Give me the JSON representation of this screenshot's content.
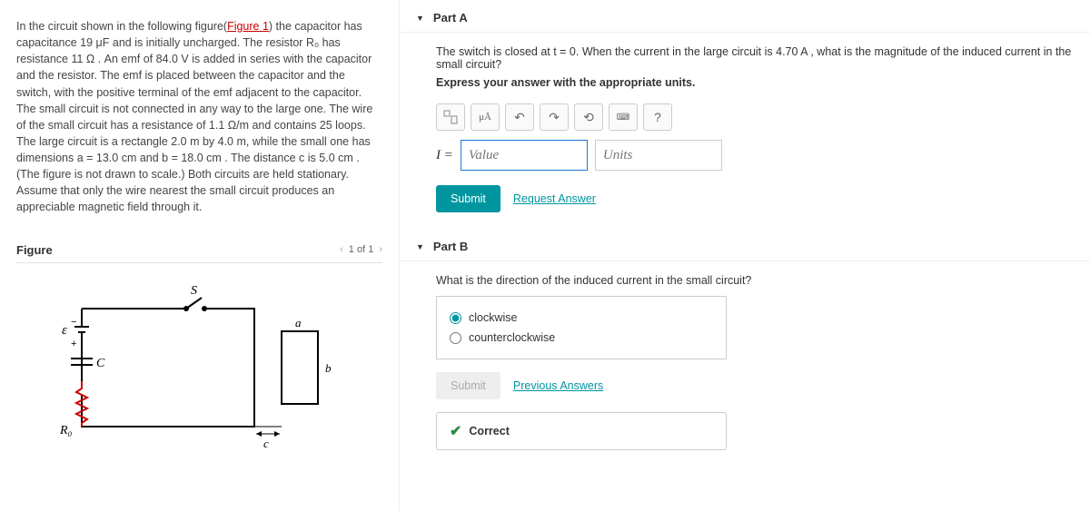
{
  "problem": {
    "text_parts": [
      "In the circuit shown in the following figure(",
      "Figure 1",
      ") the capacitor has capacitance 19 μF and is initially uncharged. The resistor R₀ has resistance 11 Ω . An emf of 84.0 V is added in series with the capacitor and the resistor. The emf is placed between the capacitor and the switch, with the positive terminal of the emf adjacent to the capacitor. The small circuit is not connected in any way to the large one. The wire of the small circuit has a resistance of 1.1 Ω/m and contains 25 loops. The large circuit is a rectangle 2.0 m by 4.0 m, while the small one has dimensions a = 13.0 cm and b = 18.0 cm . The distance c is 5.0 cm . (The figure is not drawn to scale.) Both circuits are held stationary. Assume that only the wire nearest the small circuit produces an appreciable magnetic field through it."
    ]
  },
  "figure": {
    "title": "Figure",
    "pager_current": "1 of 1",
    "labels": {
      "emf": "ε",
      "switch": "S",
      "cap": "C",
      "res": "R₀",
      "a": "a",
      "b": "b",
      "c": "c"
    }
  },
  "partA": {
    "title": "Part A",
    "question": "The switch is closed at t = 0. When the current in the large circuit is 4.70 A , what is the magnitude of the induced current in the small circuit?",
    "instruction": "Express your answer with the appropriate units.",
    "eq_symbol": "I =",
    "value_placeholder": "Value",
    "units_placeholder": "Units",
    "submit": "Submit",
    "request_answer": "Request Answer",
    "help_icon": "?"
  },
  "partB": {
    "title": "Part B",
    "question": "What is the direction of the induced current in the small circuit?",
    "choices": {
      "clockwise": "clockwise",
      "ccw": "counterclockwise"
    },
    "selected": "clockwise",
    "submit": "Submit",
    "previous": "Previous Answers",
    "feedback": "Correct"
  }
}
